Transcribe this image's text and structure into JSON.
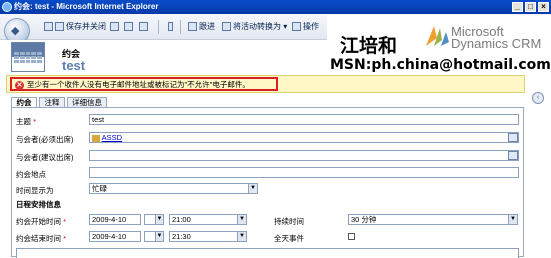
{
  "window": {
    "title": "约会: test - Microsoft Internet Explorer",
    "minimize": "_",
    "maximize": "□",
    "close": "×"
  },
  "toolbar": {
    "save_close": "保存并关闭",
    "followup": "跟进",
    "convert": "将活动转换为",
    "more": "操作"
  },
  "header": {
    "entity_type": "约会",
    "entity_name": "test"
  },
  "watermark": {
    "name": "江培和",
    "ms_line1": "Microsoft",
    "ms_line2": "Dynamics CRM",
    "msn": "MSN:ph.china@hotmail.com"
  },
  "alert": {
    "text": "至少有一个收件人没有电子邮件地址或被标记为\"不允许\"电子邮件。"
  },
  "tabs": [
    {
      "label": "约会"
    },
    {
      "label": "注释"
    },
    {
      "label": "详细信息"
    }
  ],
  "form": {
    "subject_label": "主题",
    "subject_value": "test",
    "required_attendees_label": "与会者(必须出席)",
    "required_attendees_value": "ASSD",
    "optional_attendees_label": "与会者(建议出席)",
    "location_label": "约会地点",
    "show_time_as_label": "时间显示为",
    "show_time_as_value": "忙碌",
    "schedule_section": "日程安排信息",
    "start_label": "约会开始时间",
    "start_date": "2009-4-10",
    "start_time": "21:00",
    "duration_label": "持续时间",
    "duration_value": "30 分钟",
    "end_label": "约会结束时间",
    "end_date": "2009-4-10",
    "end_time": "21:30",
    "all_day_label": "全天事件",
    "required_mark": "*"
  }
}
